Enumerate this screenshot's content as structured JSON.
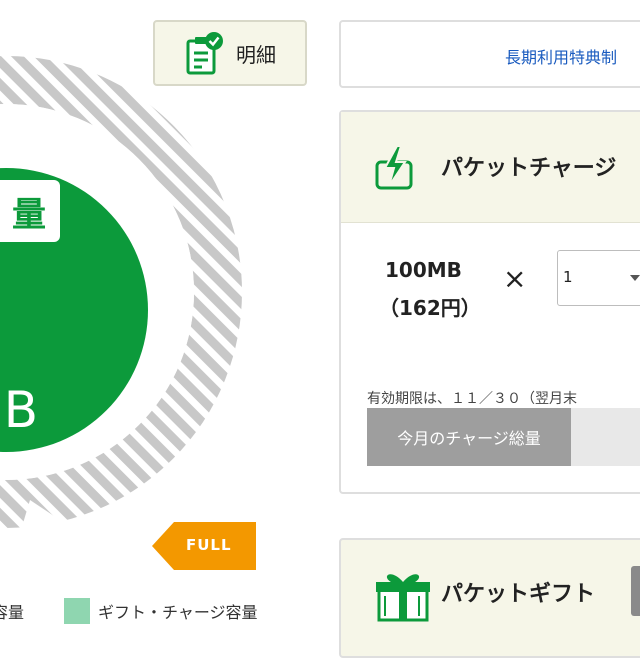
{
  "gauge": {
    "label": "量",
    "value_unit": "B",
    "full_badge": "FULL",
    "colors": {
      "main": "#0c9a3b",
      "stripe": "#c8c8c8",
      "badge": "#f39800"
    }
  },
  "legend": {
    "item1_label": "容量",
    "item2_label": "ギフト・チャージ容量",
    "item2_color": "#8fd6b0"
  },
  "detail_button": {
    "label": "明細",
    "icon": "clipboard-check-icon"
  },
  "long_term_link": {
    "label": "長期利用特典制"
  },
  "charge_panel": {
    "title": "パケットチャージ",
    "icon": "lightning-charge-icon",
    "plan_name": "100MB",
    "plan_price": "（162円）",
    "times_symbol": "×",
    "quantity": "1",
    "expiry_text": "有効期限は、１１／３０（翌月末",
    "bar_label": "今月のチャージ総量"
  },
  "gift_panel": {
    "title": "パケットギフト",
    "icon": "gift-box-icon"
  }
}
